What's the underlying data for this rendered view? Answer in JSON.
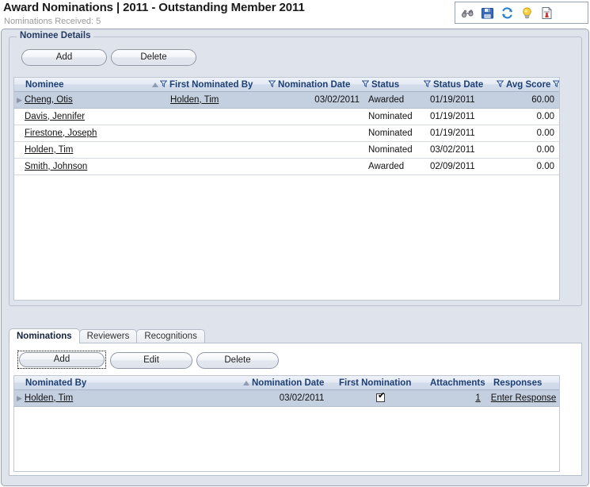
{
  "header": {
    "title": "Award Nominations | 2011 - Outstanding Member 2011",
    "subtitle": "Nominations Received: 5"
  },
  "toolbar": {
    "icons": [
      {
        "name": "binoculars-icon",
        "title": "View"
      },
      {
        "name": "save-icon",
        "title": "Save"
      },
      {
        "name": "refresh-icon",
        "title": "Refresh"
      },
      {
        "name": "lightbulb-icon",
        "title": "Help"
      },
      {
        "name": "report-icon",
        "title": "Report"
      }
    ]
  },
  "nominee_details": {
    "legend": "Nominee Details",
    "add_label": "Add",
    "delete_label": "Delete",
    "columns": [
      "Nominee",
      "First Nominated By",
      "Nomination Date",
      "Status",
      "Status Date",
      "Avg Score"
    ],
    "rows": [
      {
        "nominee": "Cheng, Otis",
        "first_nominated_by": "Holden, Tim",
        "nomination_date": "03/02/2011",
        "status": "Awarded",
        "status_date": "01/19/2011",
        "avg_score": "60.00",
        "selected": true
      },
      {
        "nominee": "Davis, Jennifer",
        "first_nominated_by": "",
        "nomination_date": "",
        "status": "Nominated",
        "status_date": "01/19/2011",
        "avg_score": "0.00",
        "selected": false
      },
      {
        "nominee": "Firestone, Joseph",
        "first_nominated_by": "",
        "nomination_date": "",
        "status": "Nominated",
        "status_date": "01/19/2011",
        "avg_score": "0.00",
        "selected": false
      },
      {
        "nominee": "Holden, Tim",
        "first_nominated_by": "",
        "nomination_date": "",
        "status": "Nominated",
        "status_date": "03/02/2011",
        "avg_score": "0.00",
        "selected": false
      },
      {
        "nominee": "Smith, Johnson",
        "first_nominated_by": "",
        "nomination_date": "",
        "status": "Awarded",
        "status_date": "02/09/2011",
        "avg_score": "0.00",
        "selected": false
      }
    ]
  },
  "tabs": [
    {
      "label": "Nominations",
      "active": true
    },
    {
      "label": "Reviewers",
      "active": false
    },
    {
      "label": "Recognitions",
      "active": false
    }
  ],
  "nominations_panel": {
    "add_label": "Add",
    "edit_label": "Edit",
    "delete_label": "Delete",
    "columns": [
      "Nominated By",
      "Nomination Date",
      "First Nomination",
      "Attachments",
      "Responses"
    ],
    "rows": [
      {
        "nominated_by": "Holden, Tim",
        "nomination_date": "03/02/2011",
        "first_nomination": true,
        "attachments": "1",
        "responses": "Enter Response",
        "selected": true
      }
    ]
  },
  "colors": {
    "panel_bg": "#dfe3ec",
    "header_text": "#1d3f77",
    "selected_row": "#c4cfe0",
    "legend_text": "#233b63",
    "subtitle_text": "#9a9a9a"
  }
}
